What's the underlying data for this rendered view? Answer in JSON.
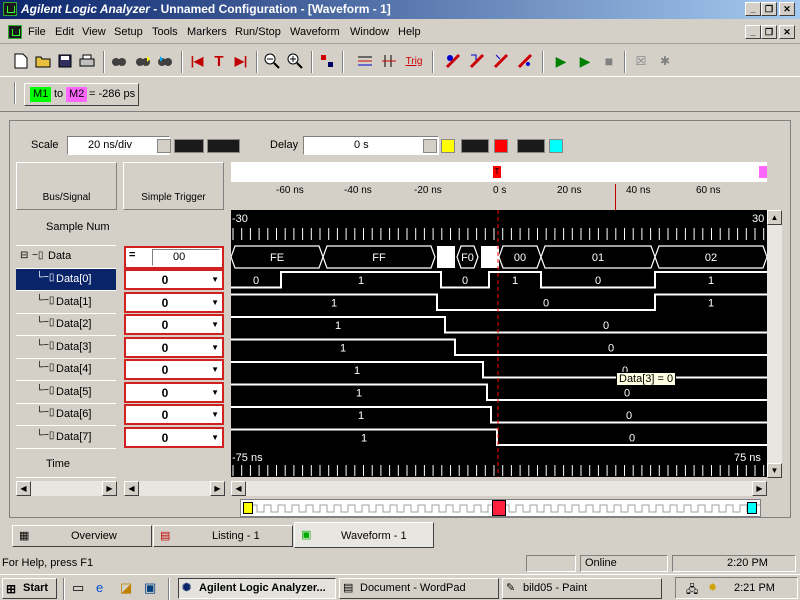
{
  "window": {
    "app_name": "Agilent Logic Analyzer",
    "title_rest": " - Unnamed Configuration - [Waveform - 1]"
  },
  "caption_buttons": [
    "_",
    "❐",
    "✕"
  ],
  "menu": [
    "File",
    "Edit",
    "View",
    "Setup",
    "Tools",
    "Markers",
    "Run/Stop",
    "Waveform",
    "Window",
    "Help"
  ],
  "markers": {
    "m1": "M1",
    "to": "to",
    "m2": "M2",
    "delta": "= -286 ps"
  },
  "scale": {
    "label": "Scale",
    "value": "20 ns/div"
  },
  "delay": {
    "label": "Delay",
    "value": "0 s"
  },
  "columns": {
    "bus_signal": "Bus/Signal",
    "simple_trigger": "Simple Trigger"
  },
  "time_axis": [
    "-60 ns",
    "-40 ns",
    "-20 ns",
    "0 s",
    "20 ns",
    "40 ns",
    "60 ns"
  ],
  "sample_row": {
    "label": "Sample Num",
    "left": "-30",
    "right": "30"
  },
  "time_row": {
    "label": "Time",
    "left": "-75 ns",
    "right": "75 ns"
  },
  "bus": {
    "name": "Data",
    "trigger_op": "=",
    "trigger_value": "00",
    "values": [
      "FE",
      "FF",
      "F0",
      "00",
      "01",
      "02"
    ]
  },
  "signals": [
    {
      "name": "Data[0]",
      "trigger": "0",
      "levels": [
        "0",
        "1",
        "0",
        "1",
        "0"
      ]
    },
    {
      "name": "Data[1]",
      "trigger": "0",
      "levels": [
        "1",
        "0",
        "1"
      ]
    },
    {
      "name": "Data[2]",
      "trigger": "0",
      "levels": [
        "1",
        "0"
      ]
    },
    {
      "name": "Data[3]",
      "trigger": "0",
      "levels": [
        "1",
        "0"
      ]
    },
    {
      "name": "Data[4]",
      "trigger": "0",
      "levels": [
        "1",
        "0"
      ]
    },
    {
      "name": "Data[5]",
      "trigger": "0",
      "levels": [
        "1",
        "0"
      ]
    },
    {
      "name": "Data[6]",
      "trigger": "0",
      "levels": [
        "1",
        "0"
      ]
    },
    {
      "name": "Data[7]",
      "trigger": "0",
      "levels": [
        "1",
        "0"
      ]
    }
  ],
  "tooltip": "Data[3] = 0",
  "tabs": [
    "Overview",
    "Listing - 1",
    "Waveform - 1"
  ],
  "status": {
    "help": "For Help, press F1",
    "online": "Online",
    "time": "2:20 PM"
  },
  "taskbar": {
    "start": "Start",
    "items": [
      "Agilent Logic Analyzer...",
      "Document - WordPad",
      "bild05 - Paint"
    ],
    "clock": "2:21 PM"
  },
  "colors": {
    "m1": "#00ff00",
    "m2": "#ff66ff",
    "trace": "#ffffff",
    "trigger_line": "#ff0000",
    "marker_line": "#c00000"
  }
}
